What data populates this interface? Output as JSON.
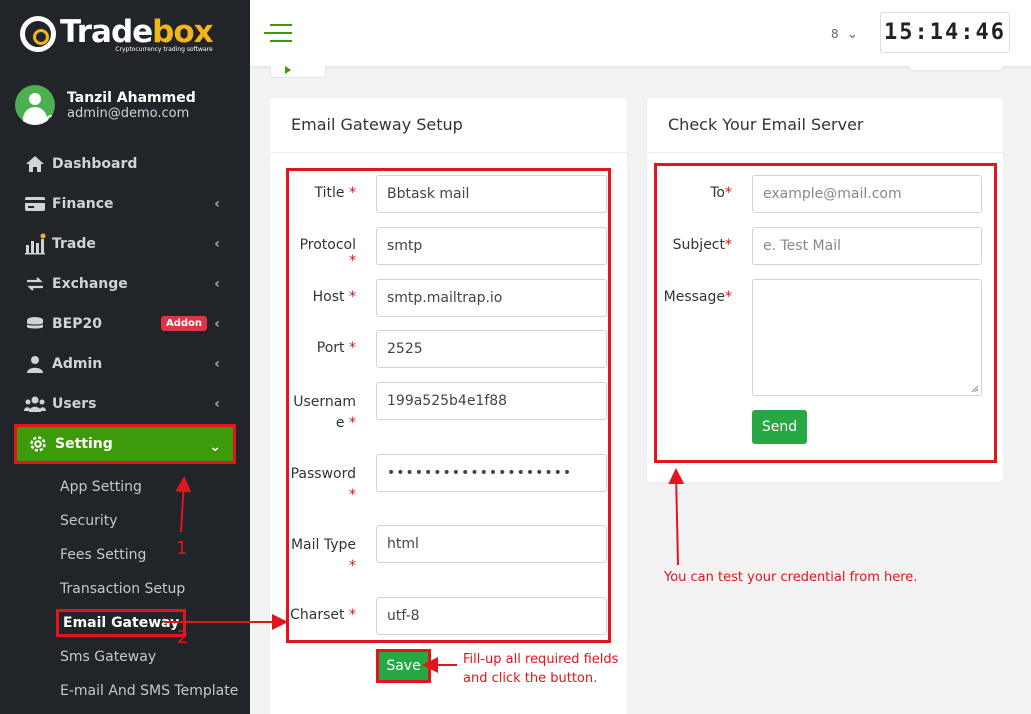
{
  "brand": {
    "name_part1": "Trade",
    "name_part2": "box",
    "tagline": "Cryptocurrency trading software"
  },
  "user": {
    "name": "Tanzil Ahammed",
    "email": "admin@demo.com"
  },
  "sidebar": {
    "items": [
      {
        "label": "Dashboard",
        "icon": "home-icon"
      },
      {
        "label": "Finance",
        "icon": "credit-card-icon"
      },
      {
        "label": "Trade",
        "icon": "chart-icon"
      },
      {
        "label": "Exchange",
        "icon": "exchange-icon"
      },
      {
        "label": "BEP20",
        "icon": "coins-icon",
        "badge": "Addon"
      },
      {
        "label": "Admin",
        "icon": "user-icon"
      },
      {
        "label": "Users",
        "icon": "users-icon"
      },
      {
        "label": "Setting",
        "icon": "gear-icon"
      }
    ],
    "submenu": [
      "App Setting",
      "Security",
      "Fees Setting",
      "Transaction Setup",
      "Email Gateway",
      "Sms Gateway",
      "E-mail And SMS Template"
    ]
  },
  "topbar": {
    "lang_value": "8",
    "clock": "15:14:46"
  },
  "email_gateway": {
    "title": "Email Gateway Setup",
    "fields": {
      "title": {
        "label": "Title",
        "value": "Bbtask mail"
      },
      "protocol": {
        "label": "Protocol",
        "value": "smtp"
      },
      "host": {
        "label": "Host",
        "value": "smtp.mailtrap.io"
      },
      "port": {
        "label": "Port",
        "value": "2525"
      },
      "username": {
        "label_line1": "Usernam",
        "label_line2": "e",
        "value": "199a525b4e1f88"
      },
      "password": {
        "label": "Password",
        "value": "••••••••••••••••••••"
      },
      "mail_type": {
        "label": "Mail Type",
        "value": "html"
      },
      "charset": {
        "label": "Charset",
        "value": "utf-8"
      }
    },
    "required_mark": "*",
    "save_label": "Save"
  },
  "email_test": {
    "title": "Check Your Email Server",
    "to": {
      "label": "To",
      "placeholder": "example@mail.com"
    },
    "subject": {
      "label": "Subject",
      "placeholder": "e. Test Mail"
    },
    "message": {
      "label": "Message"
    },
    "send_label": "Send"
  },
  "annotations": {
    "step1": "1",
    "step2": "2",
    "save_hint_line1": "Fill-up all required fields",
    "save_hint_line2": "and click the button.",
    "test_hint": "You can test your credential from here."
  },
  "colors": {
    "accent_green": "#3d9b0a",
    "button_green": "#28a745",
    "annotation_red": "#e3141d",
    "sidebar_bg": "#212529",
    "brand_yellow": "#f3b51b"
  }
}
